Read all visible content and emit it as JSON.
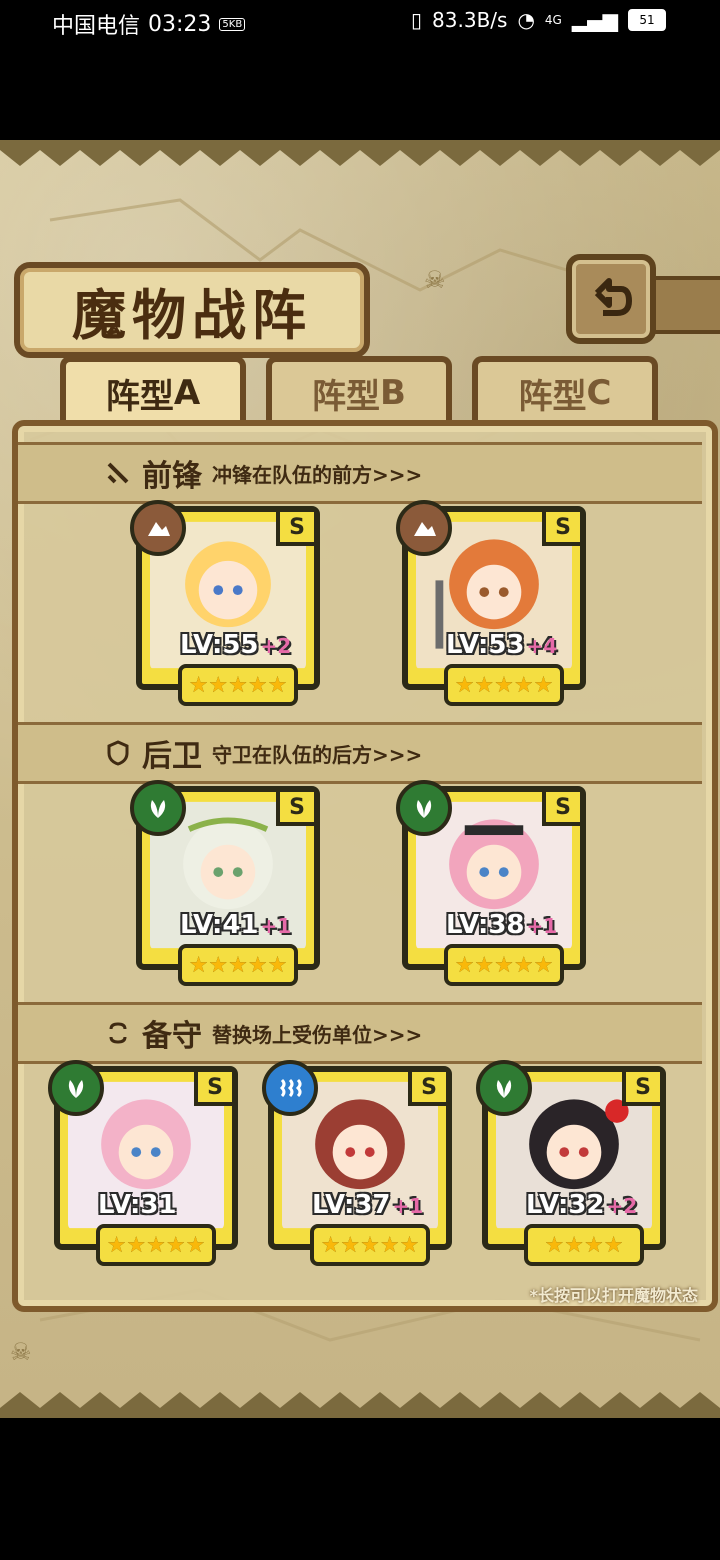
{
  "status_bar": {
    "carrier": "中国电信",
    "time": "03:23",
    "small_badge": "5KB",
    "net_speed": "83.3B/s",
    "network": "4G",
    "battery": "51"
  },
  "header": {
    "title": "魔物战阵"
  },
  "tabs": [
    {
      "label": "阵型",
      "letter": "A"
    },
    {
      "label": "阵型",
      "letter": "B"
    },
    {
      "label": "阵型",
      "letter": "C"
    }
  ],
  "sections": {
    "front": {
      "title": "前锋",
      "desc": "冲锋在队伍的前方>>>"
    },
    "back": {
      "title": "后卫",
      "desc": "守卫在队伍的后方>>>"
    },
    "reserve": {
      "title": "备守",
      "desc": "替换场上受伤单位>>>"
    }
  },
  "cards": {
    "front": [
      {
        "level": "LV:55",
        "plus": "+2",
        "rank": "S",
        "element": "earth",
        "color": "#8b5a3a",
        "stars": "★★★★★",
        "skin": "#ffd36b"
      },
      {
        "level": "LV:53",
        "plus": "+4",
        "rank": "S",
        "element": "earth",
        "color": "#8b5a3a",
        "stars": "★★★★★",
        "skin": "#e37a3a"
      }
    ],
    "back": [
      {
        "level": "LV:41",
        "plus": "+1",
        "rank": "S",
        "element": "wood",
        "color": "#2f7b33",
        "stars": "★★★★★",
        "skin": "#eef0e4"
      },
      {
        "level": "LV:38",
        "plus": "+1",
        "rank": "S",
        "element": "wood",
        "color": "#2f7b33",
        "stars": "★★★★★",
        "skin": "#f2a5bd"
      }
    ],
    "reserve": [
      {
        "level": "LV:31",
        "plus": "",
        "rank": "S",
        "element": "wood",
        "color": "#2f7b33",
        "stars": "★★★★★",
        "skin": "#f3b2c8"
      },
      {
        "level": "LV:37",
        "plus": "+1",
        "rank": "S",
        "element": "water",
        "color": "#2e7fcf",
        "stars": "★★★★★",
        "skin": "#9b3e33"
      },
      {
        "level": "LV:32",
        "plus": "+2",
        "rank": "S",
        "element": "wood",
        "color": "#2f7b33",
        "stars": "★★★★",
        "skin": "#2a2428"
      }
    ]
  },
  "hint": "*长按可以打开魔物状态"
}
